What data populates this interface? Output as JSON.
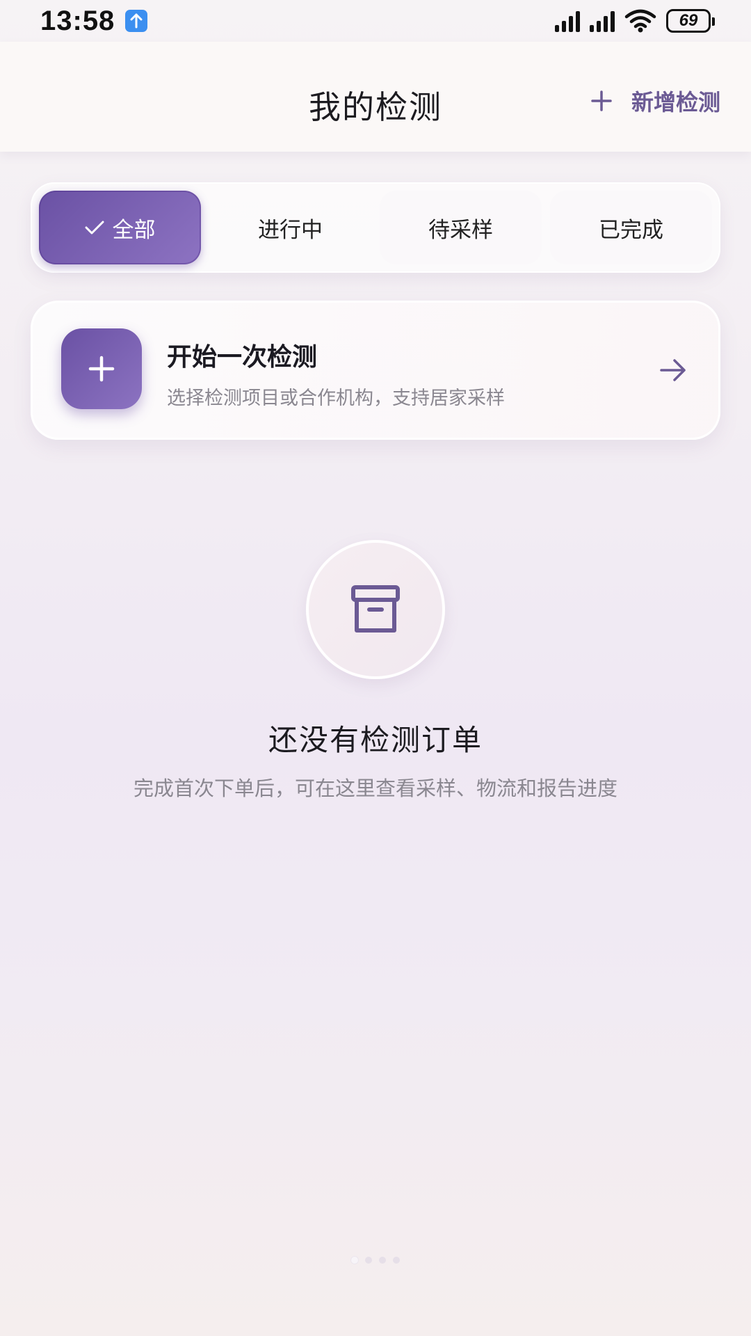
{
  "status_bar": {
    "time": "13:58",
    "battery": "69"
  },
  "header": {
    "title": "我的检测",
    "add_label": "新增检测"
  },
  "tabs": [
    {
      "label": "全部",
      "active": true
    },
    {
      "label": "进行中",
      "active": false
    },
    {
      "label": "待采样",
      "active": false
    },
    {
      "label": "已完成",
      "active": false
    }
  ],
  "start_card": {
    "title": "开始一次检测",
    "subtitle": "选择检测项目或合作机构，支持居家采样"
  },
  "empty_state": {
    "icon": "archive-box-icon",
    "title": "还没有检测订单",
    "subtitle": "完成首次下单后，可在这里查看采样、物流和报告进度"
  },
  "colors": {
    "accent": "#6b5a94",
    "accent_gradient_start": "#6a51a4",
    "accent_gradient_end": "#8d73c2",
    "text_primary": "#1c1b20",
    "text_secondary": "#8a8790"
  }
}
